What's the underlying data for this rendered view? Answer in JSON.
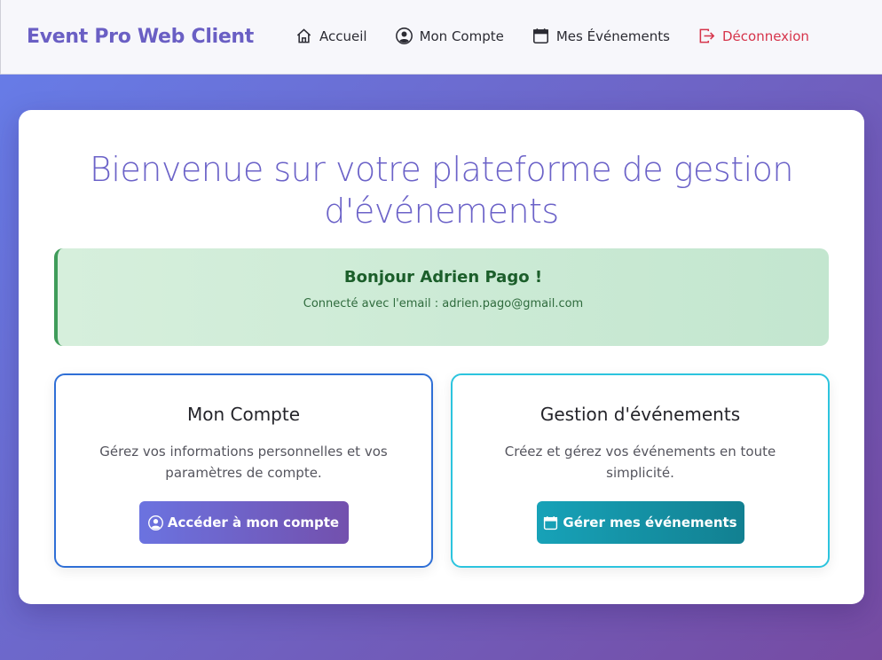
{
  "navbar": {
    "brand": "Event Pro Web Client",
    "links": [
      {
        "label": "Accueil",
        "icon": "house-icon"
      },
      {
        "label": "Mon Compte",
        "icon": "person-circle-icon"
      },
      {
        "label": "Mes Événements",
        "icon": "calendar-icon"
      },
      {
        "label": "Déconnexion",
        "icon": "logout-icon",
        "color": "#d6344b"
      }
    ]
  },
  "main": {
    "title": "Bienvenue sur votre plateforme de gestion d'événements",
    "welcome": {
      "greeting": "Bonjour Adrien Pago !",
      "email_line": "Connecté avec l'email : adrien.pago@gmail.com"
    },
    "cards": [
      {
        "title": "Mon Compte",
        "description": "Gérez vos informations personnelles et vos paramètres de compte.",
        "button": "Accéder à mon compte",
        "button_icon": "person-circle-icon",
        "border_color": "#2f6fd6"
      },
      {
        "title": "Gestion d'événements",
        "description": "Créez et gérez vos événements en toute simplicité.",
        "button": "Gérer mes événements",
        "button_icon": "calendar-icon",
        "border_color": "#2cc4de"
      }
    ]
  },
  "colors": {
    "background_start": "#667eea",
    "background_end": "#764ba2",
    "brand": "#6a5fc4",
    "success": "#1b5e2a"
  }
}
